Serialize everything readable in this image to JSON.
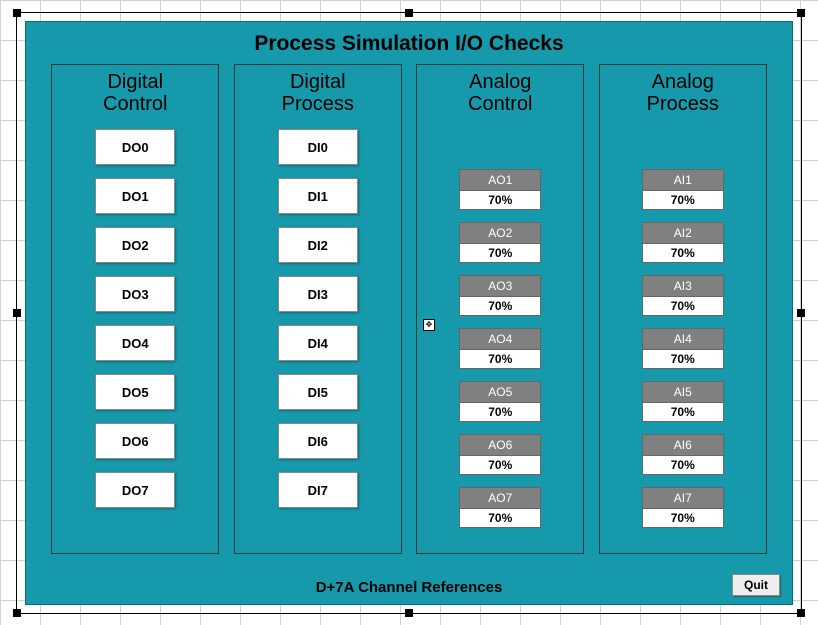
{
  "title": "Process Simulation I/O Checks",
  "footer": "D+7A Channel References",
  "quit_label": "Quit",
  "columns": {
    "digital_control": {
      "header_line1": "Digital",
      "header_line2": "Control",
      "items": [
        "DO0",
        "DO1",
        "DO2",
        "DO3",
        "DO4",
        "DO5",
        "DO6",
        "DO7"
      ]
    },
    "digital_process": {
      "header_line1": "Digital",
      "header_line2": "Process",
      "items": [
        "DI0",
        "DI1",
        "DI2",
        "DI3",
        "DI4",
        "DI5",
        "DI6",
        "DI7"
      ]
    },
    "analog_control": {
      "header_line1": "Analog",
      "header_line2": "Control",
      "items": [
        {
          "label": "AO1",
          "value": "70%"
        },
        {
          "label": "AO2",
          "value": "70%"
        },
        {
          "label": "AO3",
          "value": "70%"
        },
        {
          "label": "AO4",
          "value": "70%"
        },
        {
          "label": "AO5",
          "value": "70%"
        },
        {
          "label": "AO6",
          "value": "70%"
        },
        {
          "label": "AO7",
          "value": "70%"
        }
      ]
    },
    "analog_process": {
      "header_line1": "Analog",
      "header_line2": "Process",
      "items": [
        {
          "label": "AI1",
          "value": "70%"
        },
        {
          "label": "AI2",
          "value": "70%"
        },
        {
          "label": "AI3",
          "value": "70%"
        },
        {
          "label": "AI4",
          "value": "70%"
        },
        {
          "label": "AI5",
          "value": "70%"
        },
        {
          "label": "AI6",
          "value": "70%"
        },
        {
          "label": "AI7",
          "value": "70%"
        }
      ]
    }
  }
}
